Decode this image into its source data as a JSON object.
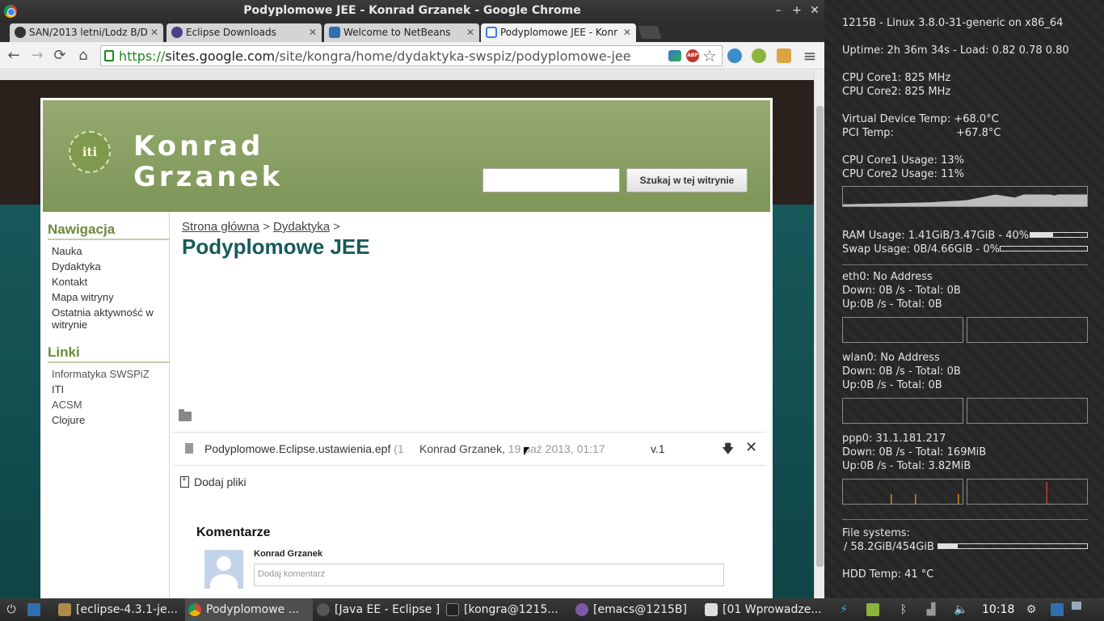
{
  "window": {
    "title": "Podyplomowe JEE - Konrad Grzanek - Google Chrome",
    "controls": {
      "minimize": "–",
      "maximize": "+",
      "close": "✕"
    }
  },
  "tabs": [
    {
      "label": "SAN/2013 letni/Lodz B/D",
      "icon": "github-icon",
      "color": "#333333"
    },
    {
      "label": "Eclipse Downloads",
      "icon": "eclipse-icon",
      "color": "#4b3f8a"
    },
    {
      "label": "Welcome to NetBeans",
      "icon": "netbeans-icon",
      "color": "#2f6fb0"
    },
    {
      "label": "Podyplomowe JEE - Konr",
      "icon": "google-sites-icon",
      "color": "#3b78e7"
    }
  ],
  "toolbar": {
    "back": "←",
    "forward": "→",
    "reload": "⟳",
    "home": "⌂",
    "url_scheme": "https://",
    "url_host": "sites.google.com",
    "url_path": "/site/kongra/home/dydaktyka-swspiz/podyplomowe-jee",
    "star": "☆",
    "menu": "≡",
    "abp_label": "ABP"
  },
  "site": {
    "logo_text": "iti",
    "title_line1": "Konrad",
    "title_line2": "Grzanek",
    "search_placeholder": "",
    "search_button": "Szukaj w tej witrynie"
  },
  "sidebar": {
    "nav_heading": "Nawigacja",
    "nav_items": [
      "Nauka",
      "Dydaktyka",
      "Kontakt",
      "Mapa witryny",
      "Ostatnia aktywność w witrynie"
    ],
    "links_heading": "Linki",
    "link_items": [
      "Informatyka SWSPiZ",
      "ITI",
      "ACSM",
      "Clojure"
    ]
  },
  "content": {
    "breadcrumb_home": "Strona główna",
    "breadcrumb_sep": ">",
    "breadcrumb_parent": "Dydaktyka",
    "page_title": "Podyplomowe JEE",
    "file": {
      "name": "Podyplomowe.Eclipse.ustawienia.epf",
      "size_prefix": "(1",
      "author": "Konrad Grzanek,",
      "date": "19 paź 2013, 01:17",
      "version": "v.1",
      "download": "🡇",
      "delete": "✕"
    },
    "add_files": "Dodaj pliki",
    "comments_heading": "Komentarze",
    "commenter": "Konrad Grzanek",
    "comment_placeholder": "Dodaj komentarz"
  },
  "conky": {
    "system": "1215B - Linux 3.8.0-31-generic on x86_64",
    "uptime": "Uptime: 2h 36m 34s - Load: 0.82 0.78 0.80",
    "core1_freq": "CPU Core1: 825 MHz",
    "core2_freq": "CPU Core2: 825 MHz",
    "vdev_temp_label": "Virtual Device Temp: +68.0°C",
    "pci_temp_label": "PCI Temp:",
    "pci_temp_value": "+67.8°C",
    "core1_usage": "CPU Core1 Usage: 13%",
    "core2_usage": "CPU Core2 Usage: 11%",
    "ram": "RAM Usage: 1.41GiB/3.47GiB - 40%",
    "ram_fraction": 0.4,
    "swap": "Swap Usage: 0B/4.66GiB - 0%",
    "swap_fraction": 0.0,
    "eth0_head": "eth0: No Address",
    "eth0_down": "Down: 0B /s - Total: 0B",
    "eth0_up": "Up:0B /s - Total: 0B",
    "wlan0_head": "wlan0: No Address",
    "wlan0_down": "Down: 0B /s - Total: 0B",
    "wlan0_up": "Up:0B /s - Total: 0B",
    "ppp0_head": "ppp0: 31.1.181.217",
    "ppp0_down": "Down: 0B /s - Total: 169MiB",
    "ppp0_up": "Up:0B /s - Total: 3.82MiB",
    "fs_heading": "File systems:",
    "fs_root": "/ 58.2GiB/454GiB",
    "fs_fraction": 0.13,
    "hdd_temp": "HDD Temp: 41 °C"
  },
  "taskbar": {
    "items": [
      "[eclipse-4.3.1-je...",
      "Podyplomowe ...",
      "[Java EE - Eclipse ]",
      "[kongra@1215...",
      "[emacs@1215B]",
      "[01 Wprowadze..."
    ],
    "clock": "10:18"
  }
}
